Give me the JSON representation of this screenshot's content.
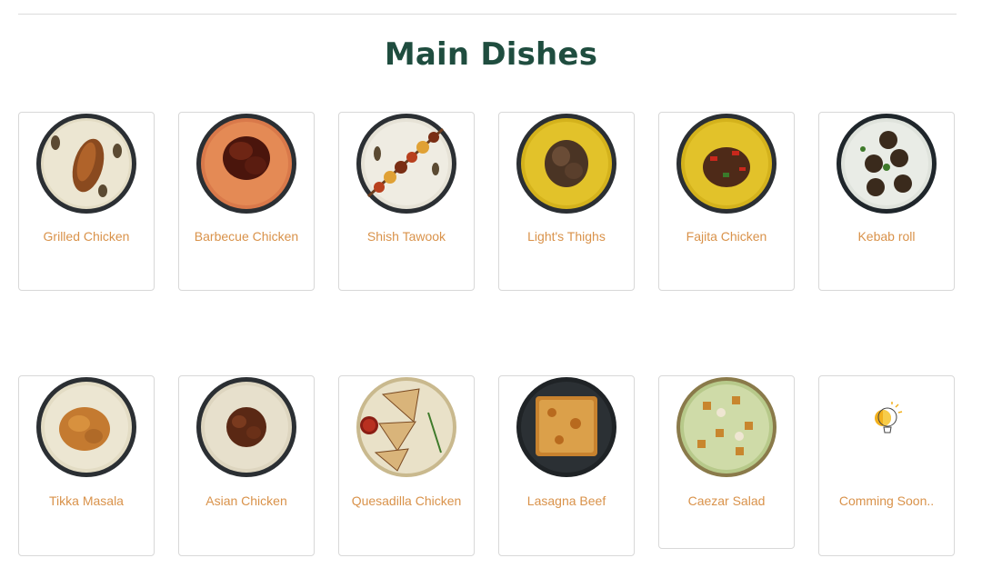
{
  "section": {
    "title": "Main Dishes"
  },
  "dishes": [
    {
      "name": "Grilled Chicken"
    },
    {
      "name": "Barbecue Chicken"
    },
    {
      "name": "Shish Tawook"
    },
    {
      "name": "Light's Thighs"
    },
    {
      "name": "Fajita Chicken"
    },
    {
      "name": "Kebab roll"
    },
    {
      "name": "Tikka Masala"
    },
    {
      "name": "Asian Chicken"
    },
    {
      "name": "Quesadilla Chicken"
    },
    {
      "name": "Lasagna Beef"
    },
    {
      "name": "Caezar Salad"
    },
    {
      "name": "Comming Soon.."
    }
  ],
  "colors": {
    "title": "#1f4d3f",
    "dish_name": "#d9924a",
    "border": "#d8d8d8"
  }
}
